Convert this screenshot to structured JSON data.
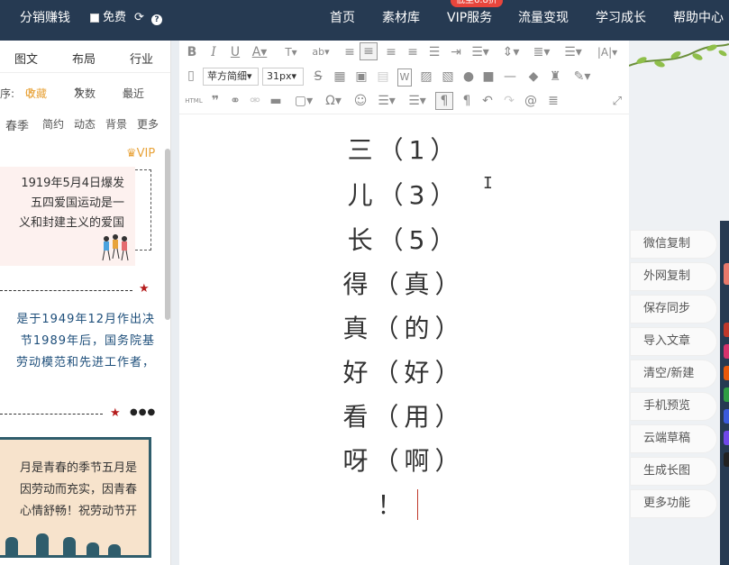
{
  "topbar": {
    "left_label": "分销赚钱",
    "free_label": "免费",
    "sale_badge": "低至6.8折",
    "nav": [
      "首页",
      "素材库",
      "VIP服务",
      "流量变现",
      "学习成长",
      "帮助中心"
    ]
  },
  "left_panel": {
    "tabs": [
      "图文",
      "布局",
      "行业"
    ],
    "sort": {
      "prefix": "序:",
      "favorites": "收藏",
      "count": "次数",
      "recent": "最近"
    },
    "categories": [
      "春季",
      "简约",
      "动态",
      "背景",
      "更多"
    ],
    "card1": {
      "vip": "VIP",
      "lines": [
        "1919年5月4日爆发",
        "五四爱国运动是一",
        "义和封建主义的爱国"
      ]
    },
    "card2": {
      "lines": [
        "是于1949年12月作出决",
        "节1989年后，国务院基",
        "劳动模范和先进工作者，"
      ]
    },
    "card3": {
      "lines": [
        "月是青春的季节五月是",
        "因劳动而充实，因青春",
        "心情舒畅！祝劳动节开"
      ]
    }
  },
  "toolbar": {
    "font_name": "苹方简细",
    "font_size": "31px",
    "html_label": "HTML"
  },
  "editor": {
    "lines": [
      "三（1）",
      "儿（3）",
      "长（5）",
      "得（真）",
      "真（的）",
      "好（好）",
      "看（用）",
      "呀（啊）",
      "！"
    ]
  },
  "side_menu": [
    "微信复制",
    "外网复制",
    "保存同步",
    "导入文章",
    "清空/新建",
    "手机预览",
    "云端草稿",
    "生成长图",
    "更多功能"
  ],
  "colors": {
    "topbar": "#263a52",
    "accent_red": "#e8453c",
    "swatches": [
      "#c0392b",
      "#d6336c",
      "#e8590c",
      "#2f9e44",
      "#3b5bdb",
      "#7048e8",
      "#222222"
    ]
  }
}
